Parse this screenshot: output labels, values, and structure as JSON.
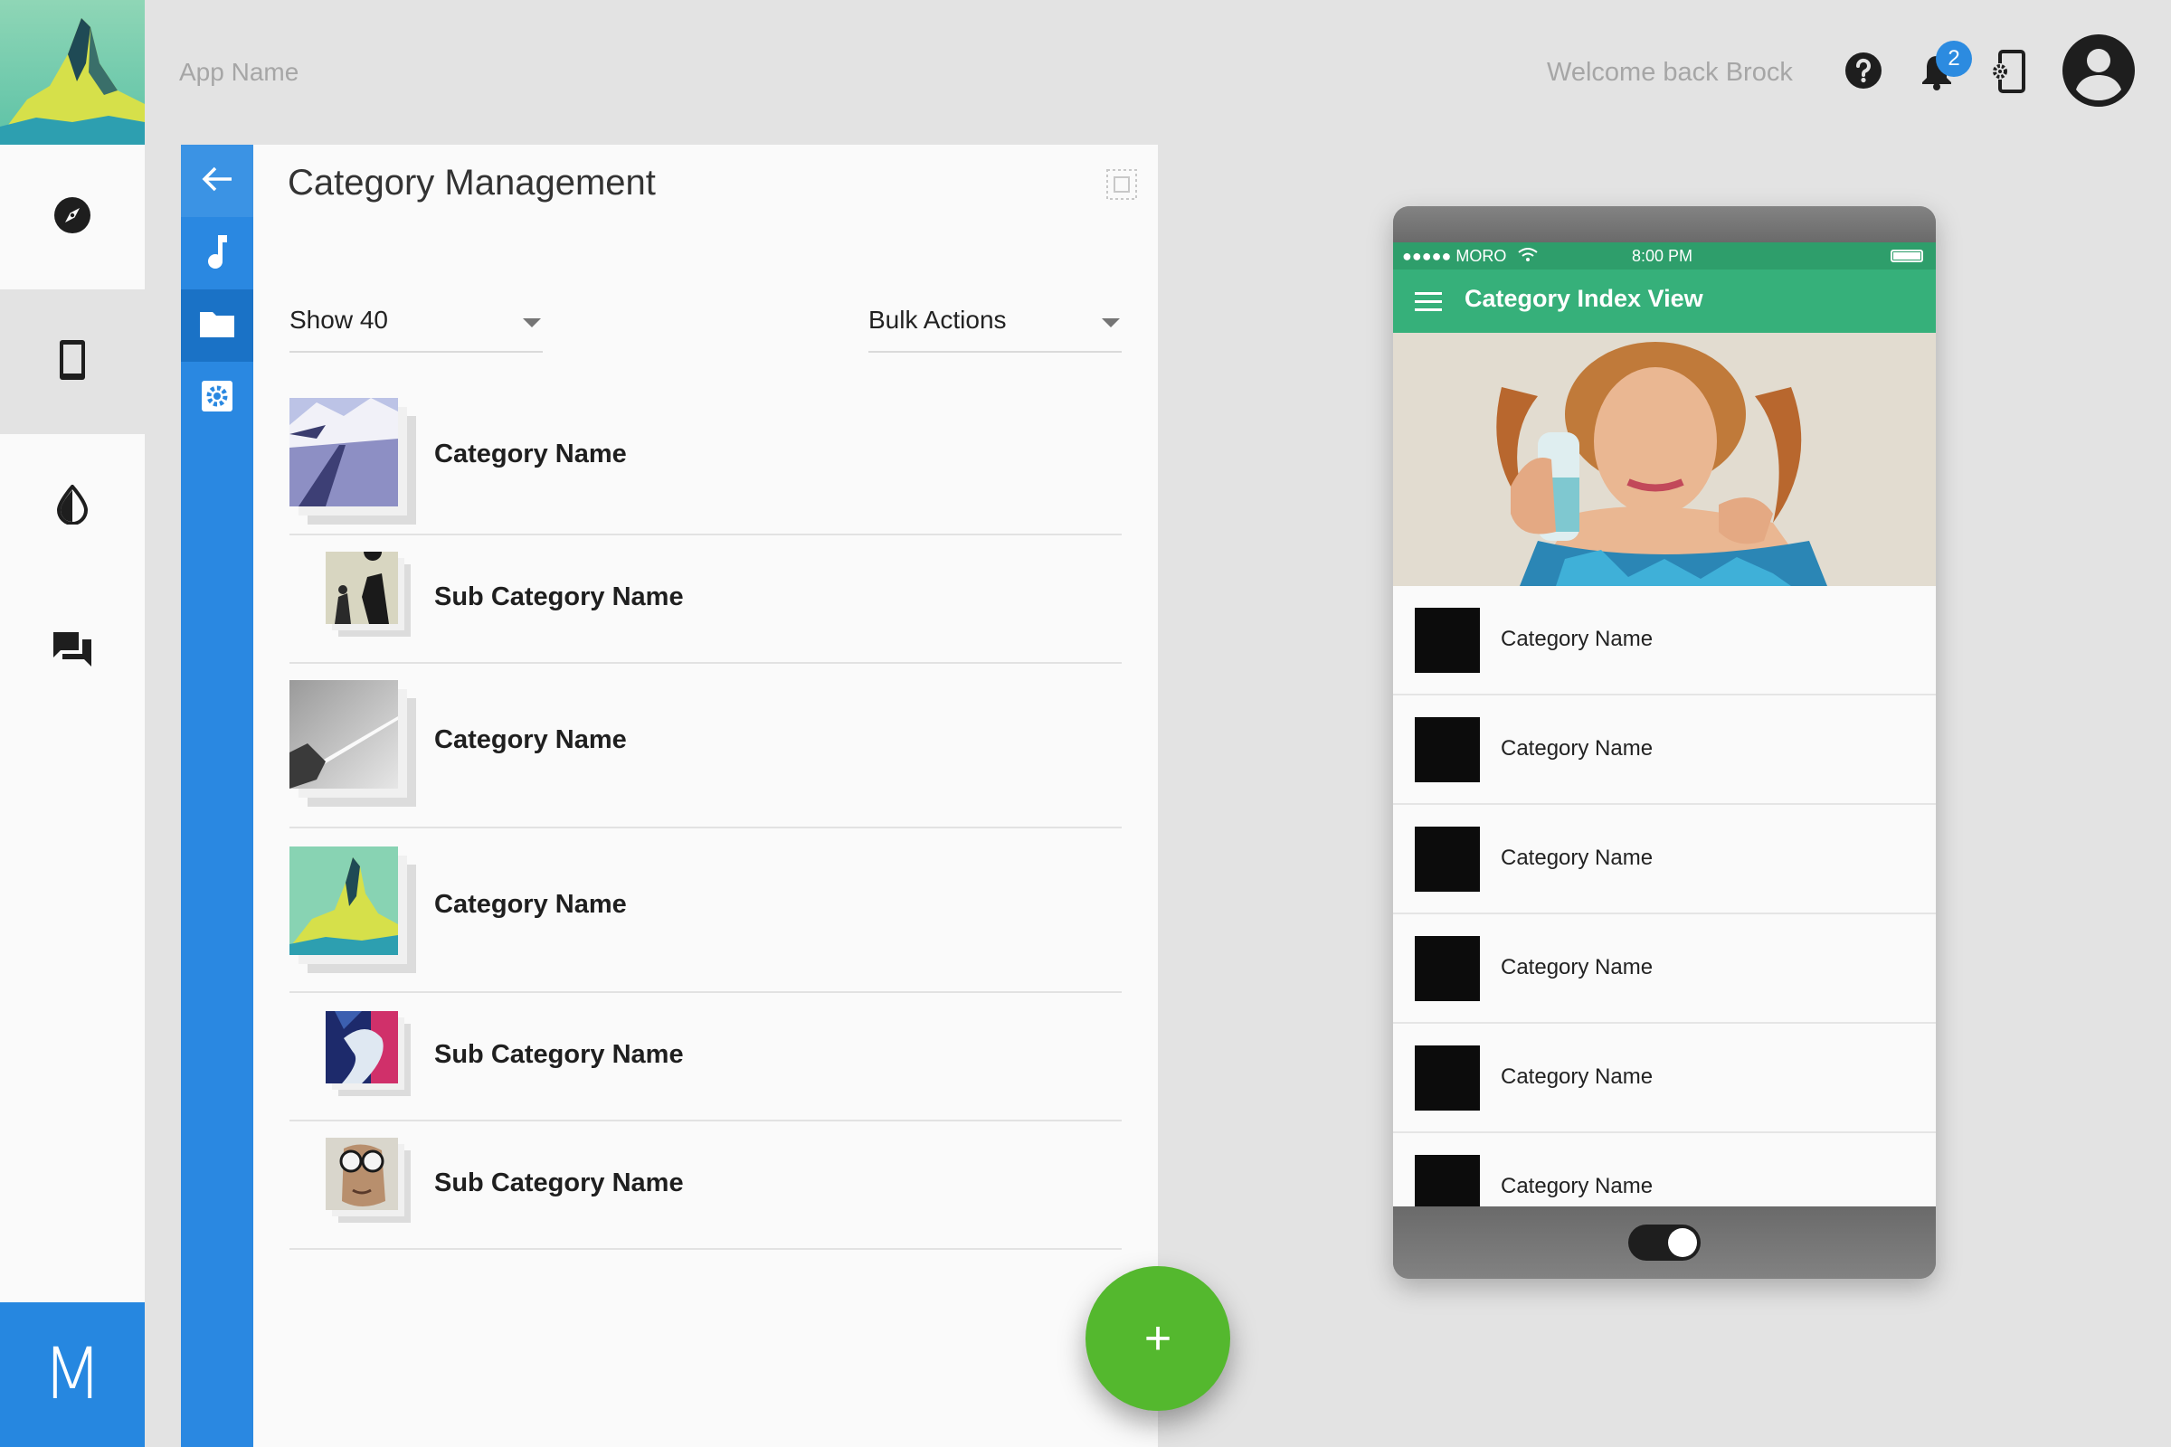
{
  "header": {
    "app_name": "App Name",
    "welcome": "Welcome back Brock",
    "notification_count": "2",
    "icons": [
      "help-icon",
      "bell-icon",
      "device-settings-icon",
      "account-icon"
    ]
  },
  "rail": {
    "brand_letter": "M",
    "items": [
      {
        "icon": "compass-icon",
        "active": false
      },
      {
        "icon": "phone-device-icon",
        "active": true
      },
      {
        "icon": "theme-drop-icon",
        "active": false
      },
      {
        "icon": "chat-icon",
        "active": false
      }
    ]
  },
  "strip": {
    "items": [
      "back-arrow-icon",
      "music-icon",
      "folder-icon",
      "settings-icon"
    ],
    "selected": "folder-icon"
  },
  "panel": {
    "title": "Category Management",
    "show_select": "Show 40",
    "bulk_select": "Bulk Actions",
    "rows": [
      {
        "label": "Category Name",
        "type": "category"
      },
      {
        "label": "Sub Category Name",
        "type": "sub"
      },
      {
        "label": "Category Name",
        "type": "category"
      },
      {
        "label": "Category Name",
        "type": "category"
      },
      {
        "label": "Sub Category Name",
        "type": "sub"
      },
      {
        "label": "Sub Category Name",
        "type": "sub"
      }
    ],
    "fab_label": "+"
  },
  "phone": {
    "carrier": "●●●●● MORO",
    "time": "8:00 PM",
    "app_title": "Category Index View",
    "items": [
      "Category Name",
      "Category Name",
      "Category Name",
      "Category Name",
      "Category Name",
      "Category Name"
    ]
  },
  "colors": {
    "accent_blue": "#2a88e1",
    "fab_green": "#54b82e",
    "phone_green": "#36b07a"
  }
}
